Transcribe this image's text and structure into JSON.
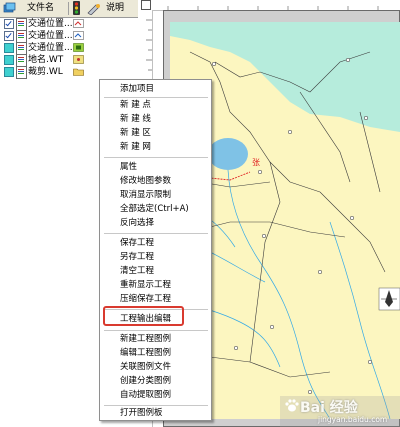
{
  "layer_panel": {
    "header": {
      "col_file": "文件名",
      "col_note": "说明"
    },
    "layers": [
      {
        "name": "交通位置...",
        "checked": true,
        "type": "line"
      },
      {
        "name": "交通位置...",
        "checked": true,
        "type": "line"
      },
      {
        "name": "交通位置...",
        "checked": false,
        "type": "line"
      },
      {
        "name": "地名.WT",
        "checked": false,
        "type": "point"
      },
      {
        "name": "裁剪.WL",
        "checked": false,
        "type": "line"
      }
    ]
  },
  "context_menu": {
    "items": [
      "添加项目",
      "新 建 点",
      "新 建 线",
      "新 建 区",
      "新 建 网",
      "属性",
      "修改地图参数",
      "取消显示限制",
      "全部选定(Ctrl+A)",
      "反向选择",
      "保存工程",
      "另存工程",
      "清空工程",
      "重新显示工程",
      "压缩保存工程",
      "工程输出编辑",
      "新建工程图例",
      "编辑工程图例",
      "关联图例文件",
      "创建分类图例",
      "自动提取图例",
      "打开图例板"
    ],
    "highlighted_item": "工程输出编辑",
    "highlight_color": "#d93a2f"
  },
  "map": {
    "label_red": "张",
    "colors": {
      "land": "#fcf6c0",
      "water": "#b6ecdc",
      "lake": "#7fc2e6",
      "river": "#33a9e6",
      "road": "#3a3a3a",
      "red": "#e02020"
    }
  },
  "watermark": {
    "brand": "Bai 经验",
    "url": "jingyan.baidu.com"
  }
}
